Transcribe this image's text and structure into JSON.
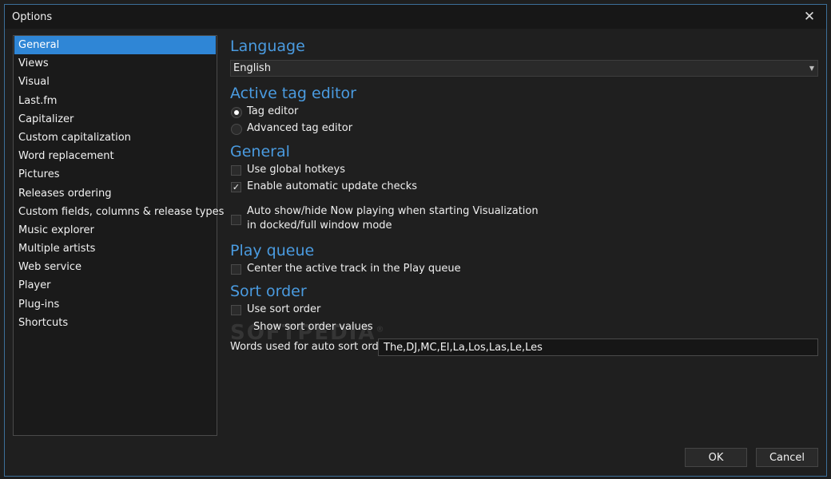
{
  "window": {
    "title": "Options",
    "close_icon": "close-icon"
  },
  "sidebar": {
    "items": [
      {
        "label": "General",
        "selected": true
      },
      {
        "label": "Views"
      },
      {
        "label": "Visual"
      },
      {
        "label": "Last.fm"
      },
      {
        "label": "Capitalizer"
      },
      {
        "label": "Custom capitalization"
      },
      {
        "label": "Word replacement"
      },
      {
        "label": "Pictures"
      },
      {
        "label": "Releases ordering"
      },
      {
        "label": "Custom fields, columns & release types"
      },
      {
        "label": "Music explorer"
      },
      {
        "label": "Multiple artists"
      },
      {
        "label": "Web service"
      },
      {
        "label": "Player"
      },
      {
        "label": "Plug-ins"
      },
      {
        "label": "Shortcuts"
      }
    ]
  },
  "language": {
    "title": "Language",
    "selected": "English"
  },
  "tag_editor": {
    "title": "Active tag editor",
    "options": [
      {
        "label": "Tag editor",
        "checked": true
      },
      {
        "label": "Advanced tag editor",
        "checked": false
      }
    ]
  },
  "general": {
    "title": "General",
    "use_global_hotkeys": {
      "label": "Use global hotkeys",
      "checked": false
    },
    "auto_update": {
      "label": "Enable automatic update checks",
      "checked": true
    },
    "auto_show_line1": "Auto show/hide Now playing when starting Visualization",
    "auto_show_line2": "in docked/full window mode",
    "auto_show_checked": false
  },
  "play_queue": {
    "title": "Play queue",
    "center_track": {
      "label": "Center the active track in the Play queue",
      "checked": false
    }
  },
  "sort_order": {
    "title": "Sort order",
    "use_sort_order": {
      "label": "Use sort order",
      "checked": false
    },
    "show_values": {
      "label": "Show sort order values",
      "checked": false
    },
    "words_label": "Words used for auto sort order",
    "words_value": "The,DJ,MC,El,La,Los,Las,Le,Les"
  },
  "watermark": {
    "text": "SOFTPEDIA",
    "mark": "®"
  },
  "buttons": {
    "ok": "OK",
    "cancel": "Cancel"
  },
  "colors": {
    "accent": "#2f86d6",
    "section_title": "#4a9be0",
    "background": "#1f1f1f"
  }
}
